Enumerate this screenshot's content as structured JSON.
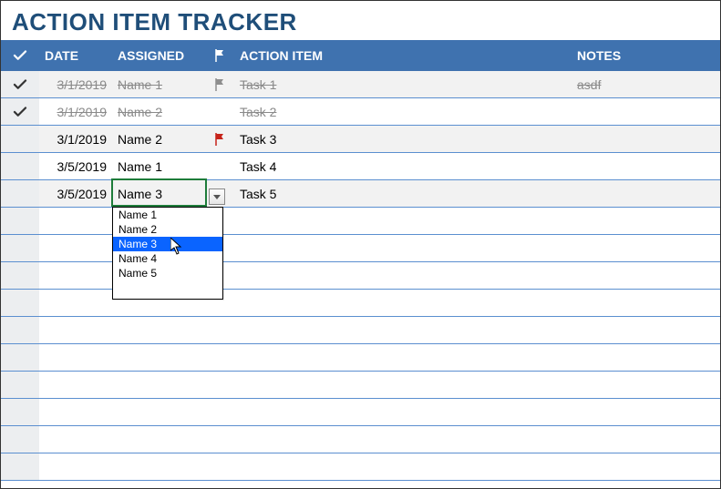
{
  "title": "ACTION ITEM TRACKER",
  "columns": {
    "date": "DATE",
    "assigned": "ASSIGNED",
    "action": "ACTION ITEM",
    "notes": "NOTES"
  },
  "rows": [
    {
      "done": true,
      "date": "3/1/2019",
      "assigned": "Name 1",
      "flag": "gray",
      "action": "Task 1",
      "notes": "asdf",
      "alt": true
    },
    {
      "done": true,
      "date": "3/1/2019",
      "assigned": "Name 2",
      "flag": "",
      "action": "Task 2",
      "notes": "",
      "alt": false
    },
    {
      "done": false,
      "date": "3/1/2019",
      "assigned": "Name 2",
      "flag": "red",
      "action": "Task 3",
      "notes": "",
      "alt": true
    },
    {
      "done": false,
      "date": "3/5/2019",
      "assigned": "Name 1",
      "flag": "",
      "action": "Task 4",
      "notes": "",
      "alt": false
    },
    {
      "done": false,
      "date": "3/5/2019",
      "assigned": "Name 3",
      "flag": "",
      "action": "Task 5",
      "notes": "",
      "alt": true,
      "active": true
    }
  ],
  "empty_row_count": 10,
  "dropdown": {
    "options": [
      "Name 1",
      "Name 2",
      "Name 3",
      "Name 4",
      "Name 5"
    ],
    "selected_index": 2
  }
}
